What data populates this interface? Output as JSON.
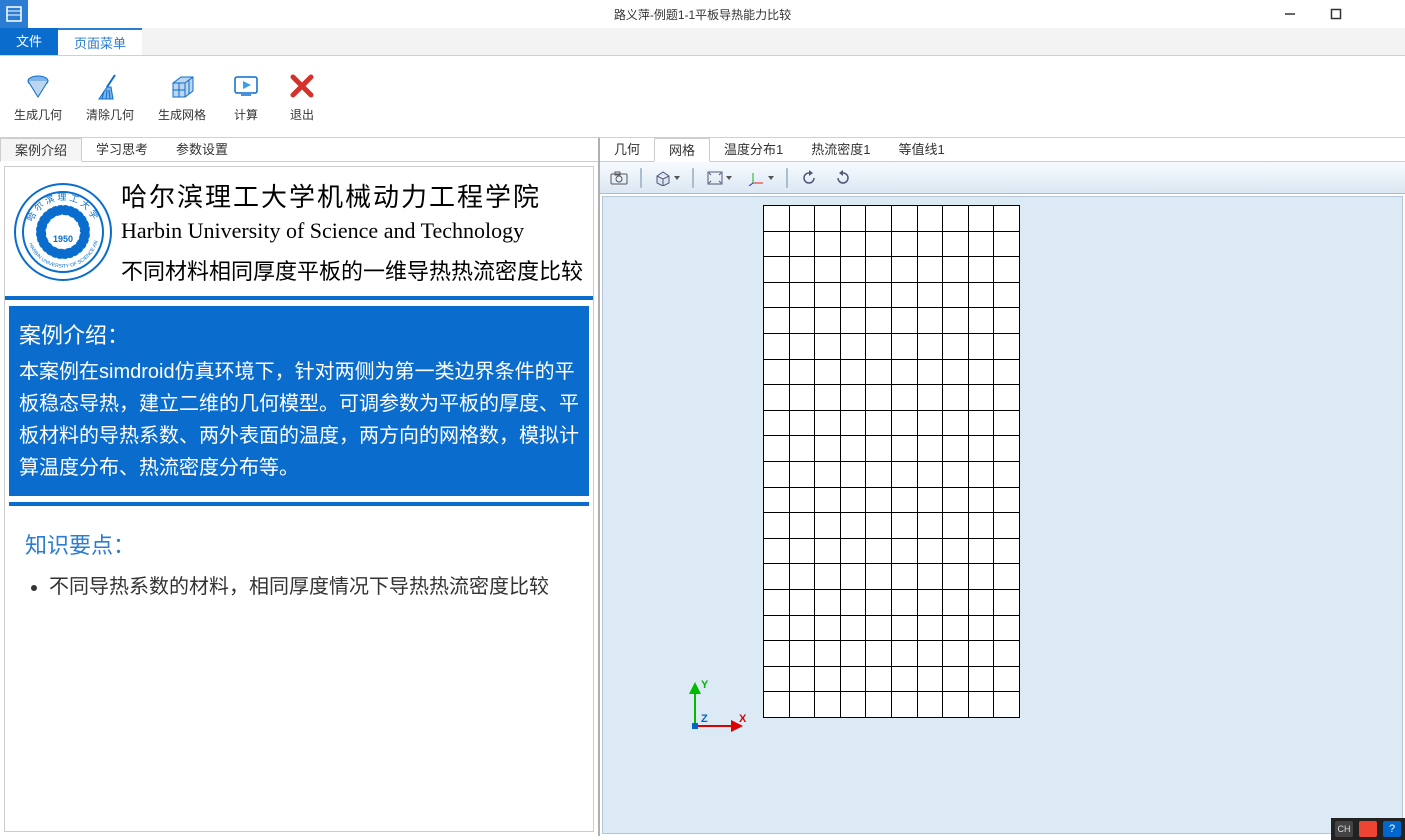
{
  "title": "路义萍-例题1-1平板导热能力比较",
  "menubar": {
    "file": "文件",
    "pagemenu": "页面菜单"
  },
  "ribbon": {
    "gen_geom": "生成几何",
    "clear_geom": "清除几何",
    "gen_mesh": "生成网格",
    "compute": "计算",
    "exit": "退出"
  },
  "left_tabs": {
    "intro": "案例介绍",
    "study": "学习思考",
    "params": "参数设置"
  },
  "right_tabs": {
    "geom": "几何",
    "mesh": "网格",
    "temp1": "温度分布1",
    "heat1": "热流密度1",
    "contour1": "等值线1"
  },
  "uni": {
    "cn": "哈尔滨理工大学机械动力工程学院",
    "en": "Harbin University of Science and Technology",
    "sub": "不同材料相同厚度平板的一维导热热流密度比较",
    "logo_year": "1950"
  },
  "case_intro": {
    "heading": "案例介绍：",
    "body": "本案例在simdroid仿真环境下，针对两侧为第一类边界条件的平板稳态导热，建立二维的几何模型。可调参数为平板的厚度、平板材料的导热系数、两外表面的温度，两方向的网格数，模拟计算温度分布、热流密度分布等。"
  },
  "knowledge": {
    "heading": "知识要点：",
    "item1": "不同导热系数的材料，相同厚度情况下导热热流密度比较"
  },
  "axes": {
    "x": "X",
    "y": "Y",
    "z": "Z"
  },
  "mesh": {
    "rows": 20,
    "cols": 10
  },
  "tray": {
    "ime": "CH"
  }
}
